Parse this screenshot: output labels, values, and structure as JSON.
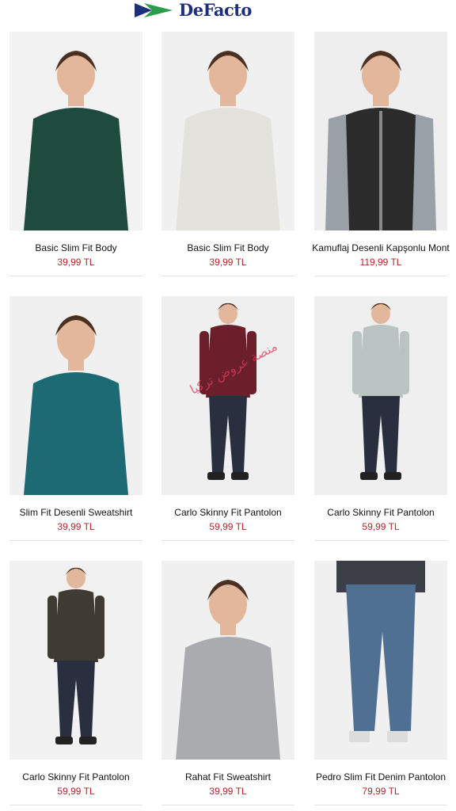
{
  "brand": {
    "name": "DeFacto",
    "colors": {
      "navy": "#1d2f7a",
      "green": "#2a9d48"
    }
  },
  "products": [
    {
      "name": "Basic Slim Fit Body",
      "price": "39,99 TL",
      "garment": "sweater",
      "color": "#1f4a3e",
      "bg": "#f2f2f2"
    },
    {
      "name": "Basic Slim Fit Body",
      "price": "39,99 TL",
      "garment": "sweater",
      "color": "#e4e2dc",
      "bg": "#f0f0f0"
    },
    {
      "name": "Kamuflaj Desenli Kapşonlu Mont",
      "price": "119,99 TL",
      "garment": "jacket",
      "color": "#2b2b2b",
      "bg": "#eeeeee"
    },
    {
      "name": "Slim Fit Desenli Sweatshirt",
      "price": "39,99 TL",
      "garment": "sweater",
      "color": "#1d6a74",
      "bg": "#f0f0f0"
    },
    {
      "name": "Carlo Skinny Fit Pantolon",
      "price": "59,99 TL",
      "garment": "fullbody",
      "color": "#6b1f2a",
      "bg": "#efefef"
    },
    {
      "name": "Carlo Skinny Fit Pantolon",
      "price": "59,99 TL",
      "garment": "fullbody",
      "color": "#b9c3c2",
      "bg": "#efefef"
    },
    {
      "name": "Carlo Skinny Fit Pantolon",
      "price": "59,99 TL",
      "garment": "fullbody",
      "color": "#3f3a32",
      "bg": "#f1f1f1"
    },
    {
      "name": "Rahat Fit Sweatshirt",
      "price": "39,99 TL",
      "garment": "sweater",
      "color": "#a9abaf",
      "bg": "#f0f0f0"
    },
    {
      "name": "Pedro Slim Fit Denim Pantolon",
      "price": "79,99 TL",
      "garment": "jeans",
      "color": "#4f6f93",
      "bg": "#f0f0f0"
    }
  ],
  "watermark": "منصة عروض تركيا"
}
